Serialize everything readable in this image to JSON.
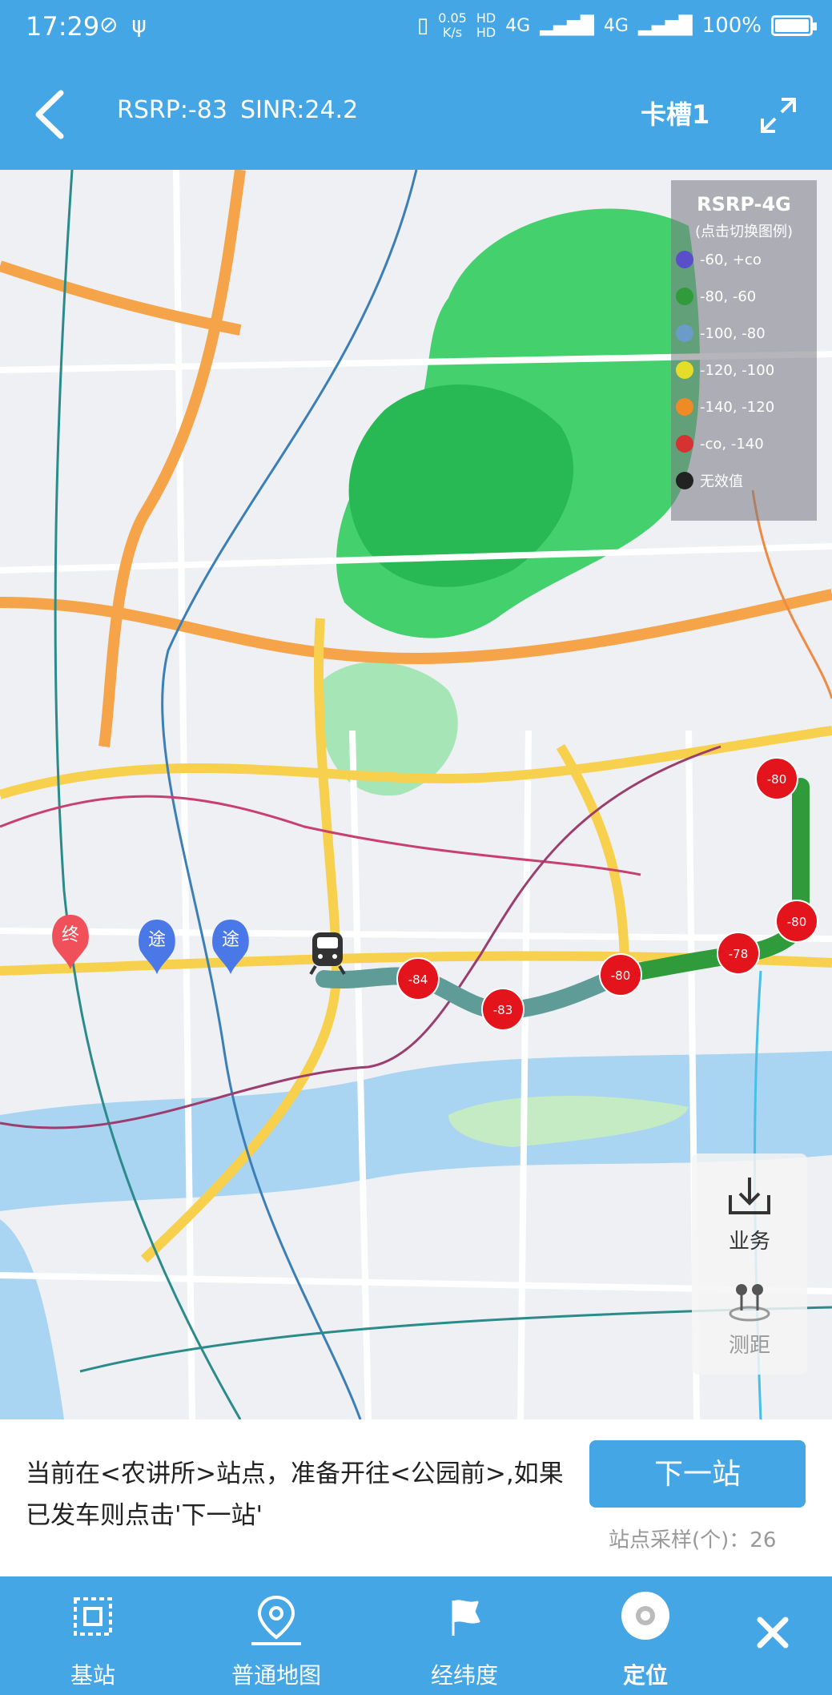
{
  "status_bar": {
    "time": "17:29",
    "net_speed_top": "0.05",
    "net_speed_bottom": "K/s",
    "hd_top": "HD",
    "hd_bottom": "HD",
    "network": "4G",
    "battery": "100%"
  },
  "header": {
    "rsrp": "RSRP:-83",
    "sinr": "SINR:24.2",
    "slot": "卡槽1"
  },
  "legend": {
    "title": "RSRP-4G",
    "subtitle": "(点击切换图例)",
    "items": [
      {
        "label": "-60, +co",
        "color": "#5a4fc8"
      },
      {
        "label": "-80, -60",
        "color": "#2f9b3a"
      },
      {
        "label": "-100, -80",
        "color": "#6b9bc8"
      },
      {
        "label": "-120, -100",
        "color": "#e6dc2a"
      },
      {
        "label": "-140, -120",
        "color": "#f08a24"
      },
      {
        "label": "-co, -140",
        "color": "#d63232"
      },
      {
        "label": "无效值",
        "color": "#222222"
      }
    ]
  },
  "map": {
    "pins": [
      {
        "label": "终",
        "color": "#f0505a"
      },
      {
        "label": "途",
        "color": "#4a78e6"
      },
      {
        "label": "途",
        "color": "#4a78e6"
      }
    ],
    "samples": [
      "-84",
      "-83",
      "-80",
      "-78",
      "-80",
      "-80"
    ]
  },
  "side_tools": {
    "business": "业务",
    "measure": "测距"
  },
  "info": {
    "message": "当前在<农讲所>站点，准备开往<公园前>,如果已发车则点击'下一站'",
    "next_button": "下一站",
    "sample_count": "站点采样(个)：26"
  },
  "bottom_nav": {
    "items": [
      {
        "label": "基站"
      },
      {
        "label": "普通地图"
      },
      {
        "label": "经纬度"
      },
      {
        "label": "定位"
      }
    ]
  },
  "colors": {
    "primary": "#45a6e6",
    "sample_marker": "#e3141b",
    "route_good": "#2f9b3a",
    "route_mid": "#5f9c98"
  }
}
